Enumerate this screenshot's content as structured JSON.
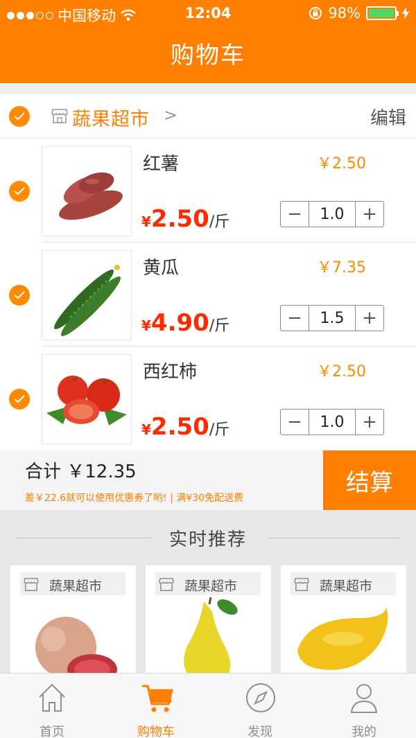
{
  "status_bar": {
    "carrier": "中国移动",
    "time": "12:04",
    "battery": "98%"
  },
  "header": {
    "title": "购物车"
  },
  "store": {
    "name": "蔬果超市",
    "arrow": ">",
    "edit_label": "编辑",
    "selected": true
  },
  "cart_items": [
    {
      "name": "红薯",
      "line_total": "￥2.50",
      "currency": "¥",
      "price": "2.50",
      "unit": "/斤",
      "quantity": "1.0",
      "minus": "−",
      "plus": "+",
      "selected": true
    },
    {
      "name": "黄瓜",
      "line_total": "￥7.35",
      "currency": "¥",
      "price": "4.90",
      "unit": "/斤",
      "quantity": "1.5",
      "minus": "−",
      "plus": "+",
      "selected": true
    },
    {
      "name": "西红柿",
      "line_total": "￥2.50",
      "currency": "¥",
      "price": "2.50",
      "unit": "/斤",
      "quantity": "1.0",
      "minus": "−",
      "plus": "+",
      "selected": true
    }
  ],
  "summary": {
    "total_label": "合计 ￥12.35",
    "tip": "差￥22.6就可以使用优惠券了哟! | 满¥30免配送费",
    "checkout_label": "结算"
  },
  "recommend": {
    "title": "实时推荐",
    "cards": [
      {
        "store": "蔬果超市"
      },
      {
        "store": "蔬果超市"
      },
      {
        "store": "蔬果超市"
      }
    ]
  },
  "tabbar": {
    "tabs": [
      {
        "label": "首页",
        "icon": "home-icon"
      },
      {
        "label": "购物车",
        "icon": "cart-icon",
        "active": true
      },
      {
        "label": "发现",
        "icon": "compass-icon"
      },
      {
        "label": "我的",
        "icon": "profile-icon"
      }
    ]
  },
  "colors": {
    "accent": "#ff7f00",
    "price": "#ff2a00",
    "battery": "#4cd964"
  }
}
